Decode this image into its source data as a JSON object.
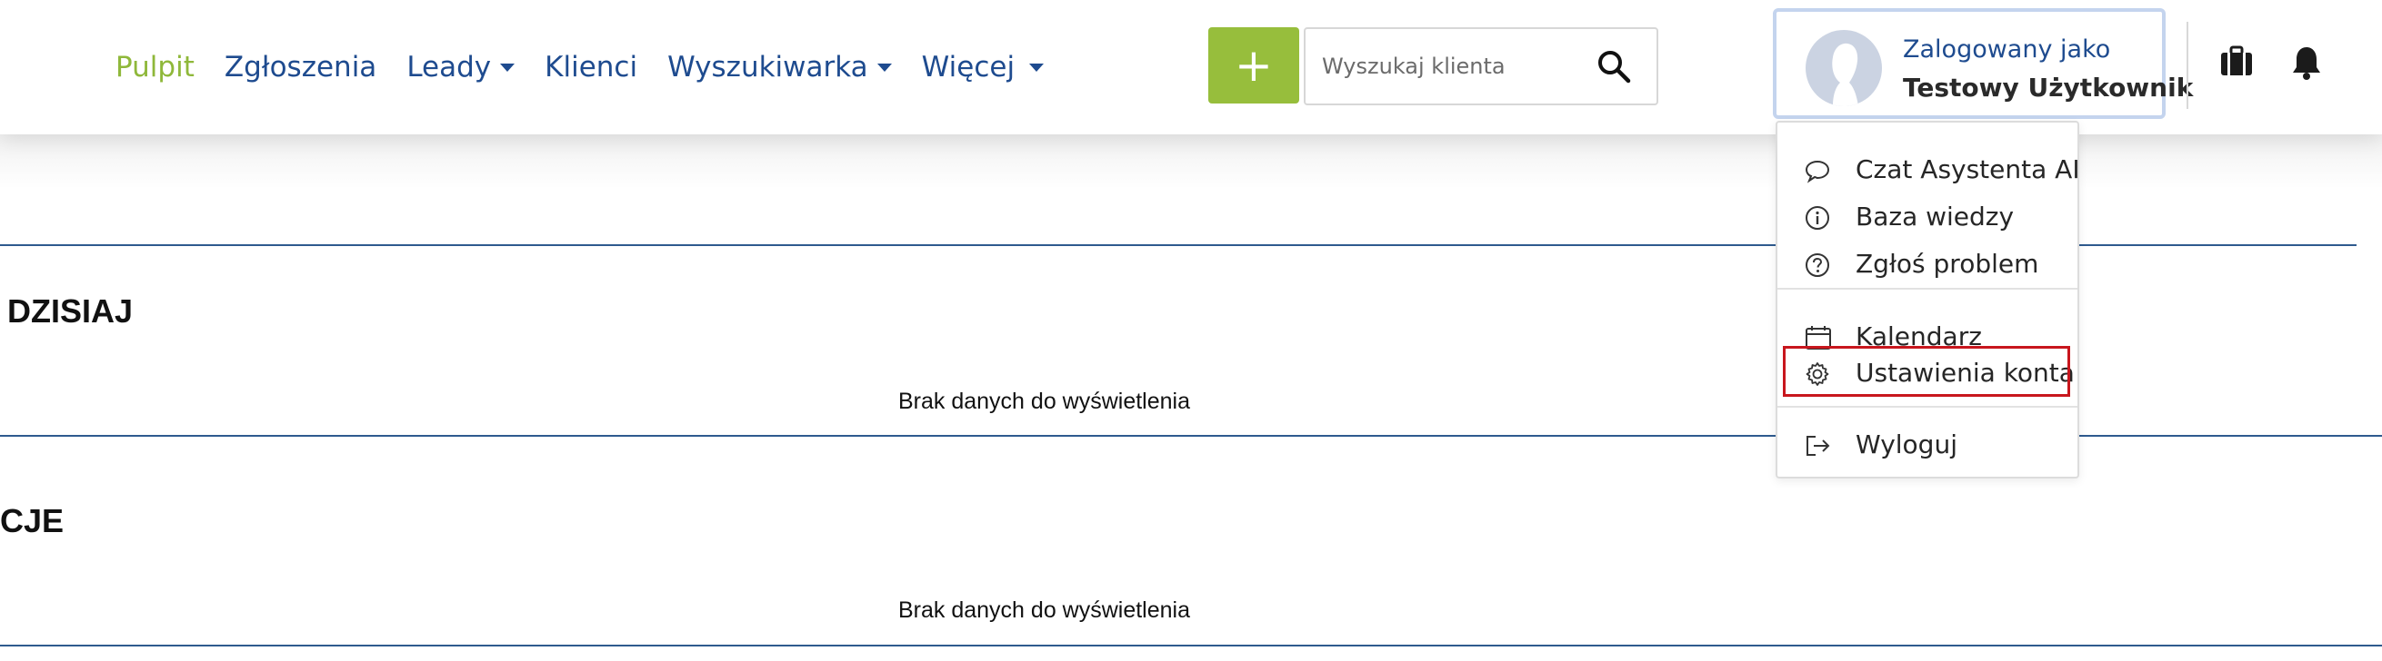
{
  "nav": {
    "items": [
      {
        "label": "Pulpit",
        "active": true,
        "dropdown": false
      },
      {
        "label": "Zgłoszenia",
        "active": false,
        "dropdown": false
      },
      {
        "label": "Leady",
        "active": false,
        "dropdown": true
      },
      {
        "label": "Klienci",
        "active": false,
        "dropdown": false
      },
      {
        "label": "Wyszukiwarka",
        "active": false,
        "dropdown": true
      },
      {
        "label": "Więcej",
        "active": false,
        "dropdown": true
      }
    ]
  },
  "toolbar": {
    "add_label": "+",
    "search_placeholder": "Wyszukaj klienta",
    "search_value": ""
  },
  "user": {
    "logged_as": "Zalogowany jako",
    "name": "Testowy Użytkownik"
  },
  "user_menu": {
    "items": [
      {
        "label": "Czat Asystenta AI",
        "icon": "chat-icon"
      },
      {
        "label": "Baza wiedzy",
        "icon": "info-icon"
      },
      {
        "label": "Zgłoś problem",
        "icon": "help-icon"
      },
      {
        "label": "Kalendarz",
        "icon": "calendar-icon"
      },
      {
        "label": "Ustawienia konta",
        "icon": "settings-icon"
      },
      {
        "label": "Wyloguj",
        "icon": "logout-icon"
      }
    ]
  },
  "sections": [
    {
      "title": "DZISIAJ",
      "empty_text": "Brak danych do wyświetlenia"
    },
    {
      "title": "CJE",
      "empty_text": "Brak danych do wyświetlenia"
    }
  ],
  "colors": {
    "accent_green": "#97be3c",
    "nav_blue": "#1e4b8f",
    "highlight_red": "#c8161d"
  }
}
